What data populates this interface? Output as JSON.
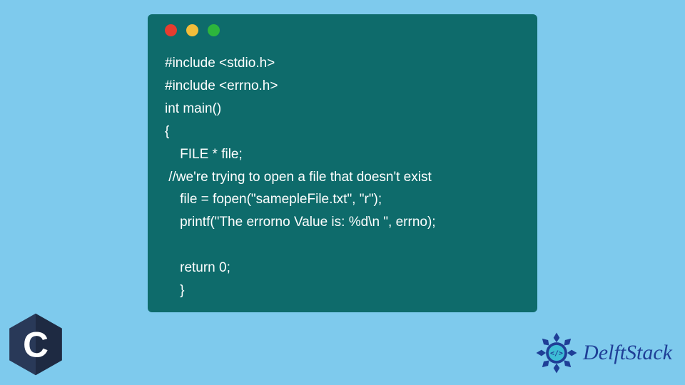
{
  "code": {
    "lines": [
      "#include <stdio.h>",
      "#include <errno.h>",
      "int main()",
      "{",
      "    FILE * file;",
      " //we're trying to open a file that doesn't exist",
      "    file = fopen(\"samepleFile.txt\", \"r\");",
      "    printf(\"The errorno Value is: %d\\n \", errno);",
      "",
      "    return 0;",
      "    }"
    ]
  },
  "brand": {
    "name": "DelftStack"
  },
  "c_logo_letter": "C"
}
